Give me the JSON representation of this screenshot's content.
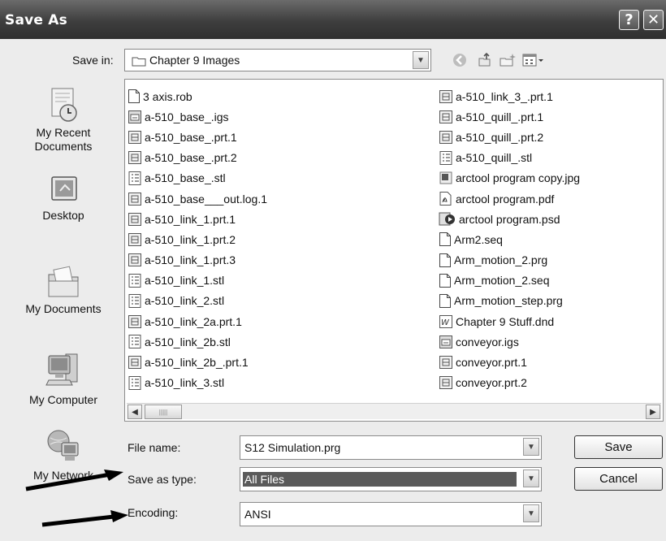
{
  "window": {
    "title": "Save As",
    "help_glyph": "?",
    "close_glyph": "✕"
  },
  "save_in": {
    "label": "Save in:",
    "value": "Chapter 9 Images"
  },
  "places": [
    {
      "label": "My Recent Documents",
      "icon": "recent-documents-icon"
    },
    {
      "label": "Desktop",
      "icon": "desktop-icon"
    },
    {
      "label": "My Documents",
      "icon": "my-documents-icon"
    },
    {
      "label": "My Computer",
      "icon": "my-computer-icon"
    },
    {
      "label": "My Network",
      "icon": "my-network-icon"
    }
  ],
  "files_col1": [
    {
      "name": "3 axis.rob",
      "icon": "blank"
    },
    {
      "name": "a-510_base_.igs",
      "icon": "igs"
    },
    {
      "name": "a-510_base_.prt.1",
      "icon": "prt"
    },
    {
      "name": "a-510_base_.prt.2",
      "icon": "prt"
    },
    {
      "name": "a-510_base_.stl",
      "icon": "stl"
    },
    {
      "name": "a-510_base___out.log.1",
      "icon": "prt"
    },
    {
      "name": "a-510_link_1.prt.1",
      "icon": "prt"
    },
    {
      "name": "a-510_link_1.prt.2",
      "icon": "prt"
    },
    {
      "name": "a-510_link_1.prt.3",
      "icon": "prt"
    },
    {
      "name": "a-510_link_1.stl",
      "icon": "stl"
    },
    {
      "name": "a-510_link_2.stl",
      "icon": "stl"
    },
    {
      "name": "a-510_link_2a.prt.1",
      "icon": "prt"
    },
    {
      "name": "a-510_link_2b.stl",
      "icon": "stl"
    },
    {
      "name": "a-510_link_2b_.prt.1",
      "icon": "prt"
    },
    {
      "name": "a-510_link_3.stl",
      "icon": "stl"
    }
  ],
  "files_col2": [
    {
      "name": "a-510_link_3_.prt.1",
      "icon": "prt"
    },
    {
      "name": "a-510_quill_.prt.1",
      "icon": "prt"
    },
    {
      "name": "a-510_quill_.prt.2",
      "icon": "prt"
    },
    {
      "name": "a-510_quill_.stl",
      "icon": "stl"
    },
    {
      "name": "arctool program copy.jpg",
      "icon": "jpg"
    },
    {
      "name": "arctool program.pdf",
      "icon": "pdf"
    },
    {
      "name": "arctool program.psd",
      "icon": "psd"
    },
    {
      "name": "Arm2.seq",
      "icon": "blank"
    },
    {
      "name": "Arm_motion_2.prg",
      "icon": "blank"
    },
    {
      "name": "Arm_motion_2.seq",
      "icon": "blank"
    },
    {
      "name": "Arm_motion_step.prg",
      "icon": "blank"
    },
    {
      "name": "Chapter 9 Stuff.dnd",
      "icon": "dnd"
    },
    {
      "name": "conveyor.igs",
      "icon": "igs"
    },
    {
      "name": "conveyor.prt.1",
      "icon": "prt"
    },
    {
      "name": "conveyor.prt.2",
      "icon": "prt"
    }
  ],
  "file_name": {
    "label": "File name:",
    "value": "S12 Simulation.prg"
  },
  "save_as_type": {
    "label": "Save as type:",
    "value": "All Files"
  },
  "encoding": {
    "label": "Encoding:",
    "value": "ANSI"
  },
  "buttons": {
    "save": "Save",
    "cancel": "Cancel"
  },
  "scrollbar": {
    "left": "◀",
    "right": "▶",
    "grip": "|||||"
  },
  "colors": {
    "titlebar": "#3e3e3e",
    "selection": "#5a5a5a"
  }
}
